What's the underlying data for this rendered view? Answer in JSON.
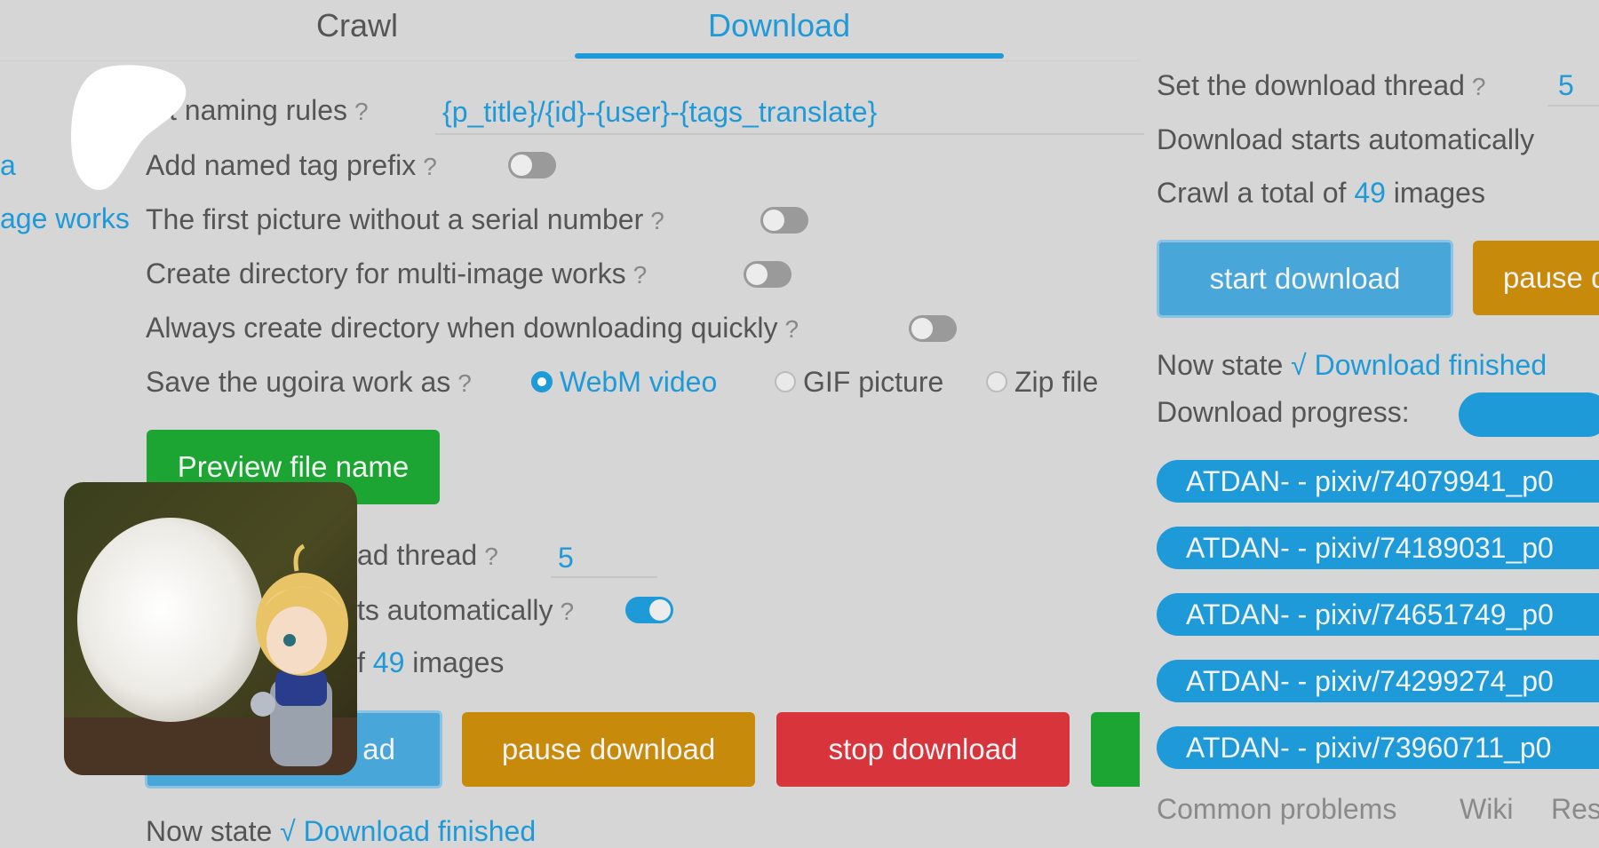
{
  "tabs": [
    "Crawl",
    "Download"
  ],
  "settings": {
    "naming_rules_label": "t naming rules",
    "naming_rules_value": "{p_title}/{id}-{user}-{tags_translate}",
    "sidebar_fragment_a": "a",
    "sidebar_fragment_works": "age works",
    "tag_prefix_label": "Add named tag prefix",
    "first_picture_label": "The first picture without a serial number",
    "multi_dir_label": "Create directory for multi-image works",
    "always_dir_label": "Always create directory when downloading quickly",
    "ugoira_label": "Save the ugoira work as",
    "ugoira_options": [
      "WebM video",
      "GIF picture",
      "Zip file"
    ],
    "help_mark": "?"
  },
  "buttons": {
    "preview": "Preview file name",
    "start_partial": "ad",
    "pause": "pause download",
    "stop": "stop download",
    "start": "start download",
    "pause_partial": "pause d"
  },
  "thread_left": {
    "label_fragment": "ad thread",
    "value": "5"
  },
  "auto_left_fragment": "ts automatically",
  "total_left": {
    "prefix": "f",
    "count": "49",
    "suffix": "images"
  },
  "state_left": {
    "label": "Now state",
    "value": "√ Download finished"
  },
  "right": {
    "thread_label": "Set the download thread",
    "thread_value": "5",
    "auto_label": "Download starts automatically",
    "total_prefix": "Crawl a total of",
    "total_count": "49",
    "total_suffix": "images",
    "state_label": "Now state",
    "state_value": "√ Download finished",
    "progress_label": "Download progress:",
    "progress_fraction": 1.0,
    "files": [
      "ATDAN- - pixiv/74079941_p0",
      "ATDAN- - pixiv/74189031_p0",
      "ATDAN- - pixiv/74651749_p0",
      "ATDAN- - pixiv/74299274_p0",
      "ATDAN- - pixiv/73960711_p0"
    ],
    "footer_links": [
      "Common problems",
      "Wiki",
      "Res"
    ]
  },
  "colors": {
    "accent": "#1e9ad8",
    "green": "#1da534",
    "orange": "#c88a0b",
    "red": "#d8343c",
    "background": "#d6d6d6"
  }
}
